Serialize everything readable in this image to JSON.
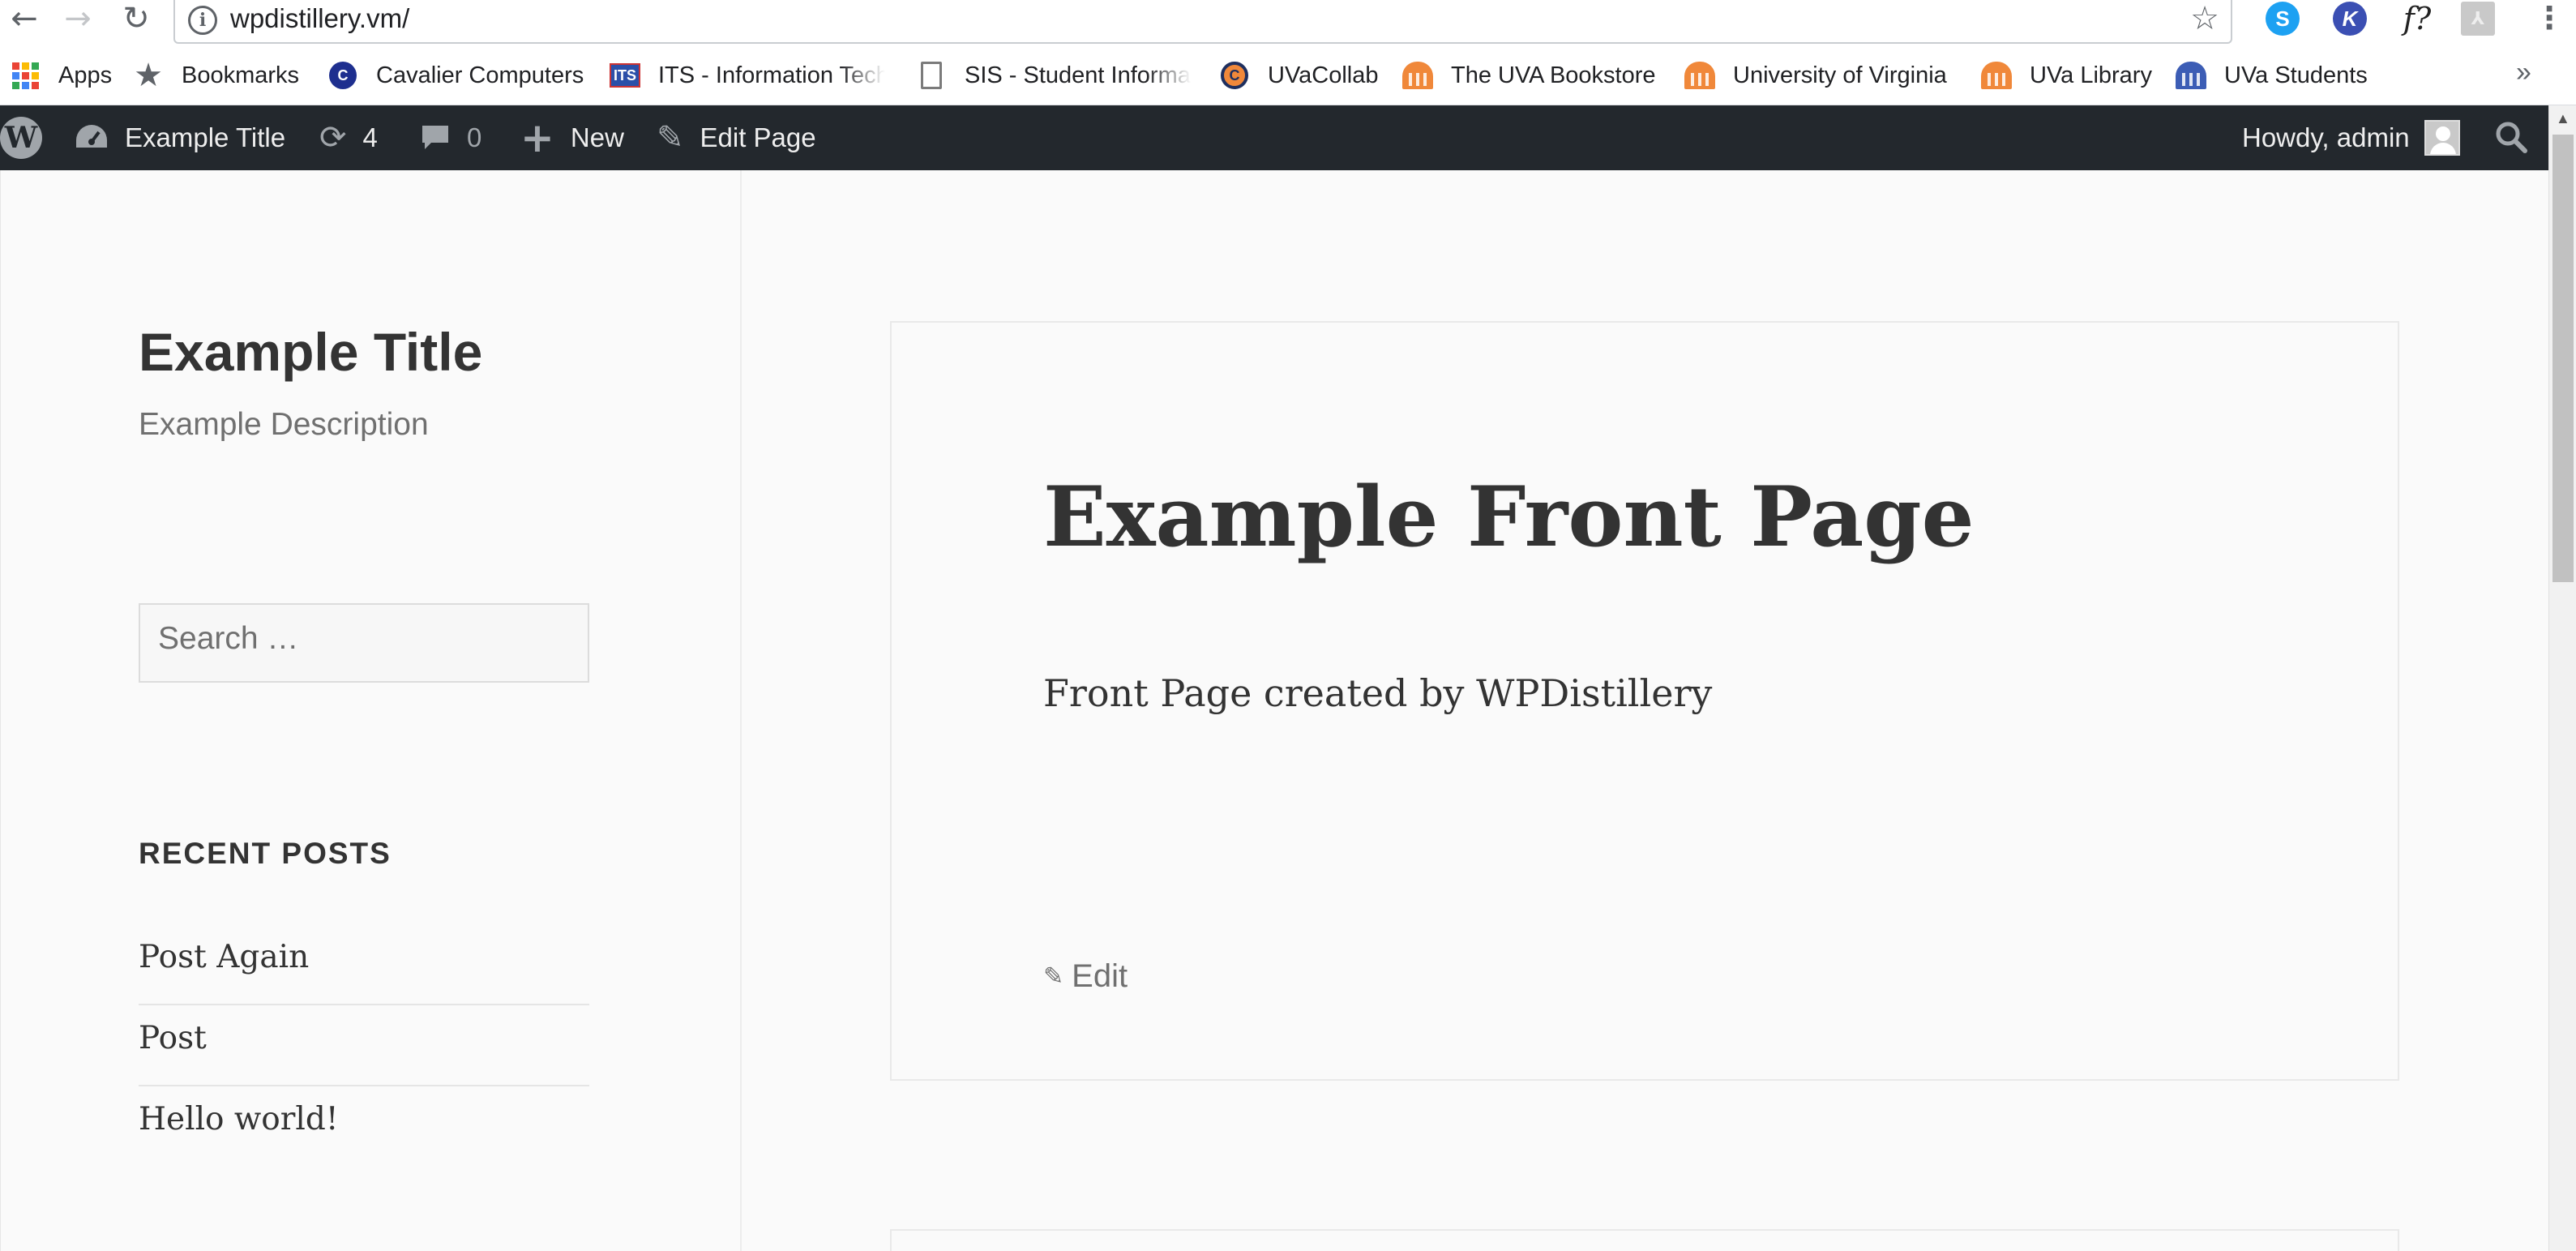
{
  "browser": {
    "url": "wpdistillery.vm/",
    "back_icon": "←",
    "forward_icon": "→",
    "reload_icon": "↻",
    "info_icon": "i",
    "star_icon": "☆",
    "ext_skype": "S",
    "ext_k": "K",
    "ext_f": "f?",
    "ext_pdf": "⅄",
    "menu_icon": "⋮",
    "more_bookmarks": "»"
  },
  "bookmarks": [
    {
      "label": "Apps"
    },
    {
      "label": "Bookmarks"
    },
    {
      "label": "Cavalier Computers",
      "icon_text": "C"
    },
    {
      "label": "ITS - Information Tech",
      "icon_text": "ITS"
    },
    {
      "label": "SIS - Student Informa"
    },
    {
      "label": "UVaCollab",
      "icon_text": "C"
    },
    {
      "label": "The UVA Bookstore"
    },
    {
      "label": "University of Virginia"
    },
    {
      "label": "UVa Library"
    },
    {
      "label": "UVa Students"
    }
  ],
  "colors": {
    "adminbar_bg": "#23282d",
    "building_orange": "#f0883a",
    "building_blue": "#3c5db5"
  },
  "adminbar": {
    "wp_logo": "W",
    "site_name": "Example Title",
    "updates_icon": "⟳",
    "updates_count": "4",
    "comments_icon": "💬",
    "comments_count": "0",
    "new_icon": "+",
    "new_label": "New",
    "edit_icon": "✎",
    "edit_label": "Edit Page",
    "howdy": "Howdy, admin"
  },
  "sidebar": {
    "site_title": "Example Title",
    "site_description": "Example Description",
    "search_placeholder": "Search …",
    "recent_posts_title": "RECENT POSTS",
    "recent_posts": [
      "Post Again",
      "Post",
      "Hello world!"
    ]
  },
  "main": {
    "entry_title": "Example Front Page",
    "entry_content": "Front Page created by WPDistillery",
    "edit_icon": "✎",
    "edit_label": "Edit"
  }
}
